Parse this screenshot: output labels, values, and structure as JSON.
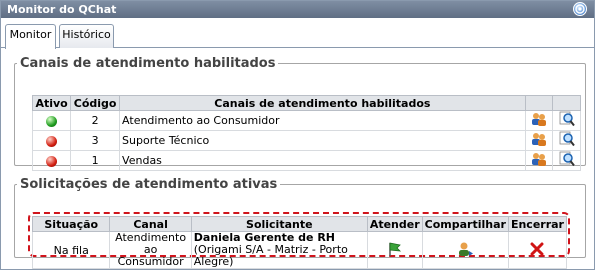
{
  "window": {
    "title": "Monitor do QChat"
  },
  "tabs": [
    {
      "label": "Monitor",
      "active": true
    },
    {
      "label": "Histórico",
      "active": false
    }
  ],
  "channels": {
    "legend": "Canais de atendimento habilitados",
    "columns": [
      "Ativo",
      "Código",
      "Canais de atendimento habilitados",
      "",
      ""
    ],
    "rows": [
      {
        "status": "green",
        "code": "2",
        "name": "Atendimento ao Consumidor"
      },
      {
        "status": "red",
        "code": "3",
        "name": "Suporte Técnico"
      },
      {
        "status": "red",
        "code": "1",
        "name": "Vendas"
      }
    ]
  },
  "requests": {
    "legend": "Solicitações de atendimento ativas",
    "columns": [
      "Situação",
      "Canal",
      "Solicitante",
      "Atender",
      "Compartilhar",
      "Encerrar"
    ],
    "rows": [
      {
        "situation": "Na fila",
        "channel": "Atendimento ao Consumidor",
        "requester_name": "Daniela Gerente de RH",
        "requester_org": " (Origami S/A - Matriz - Porto Alegre)"
      }
    ]
  },
  "colors": {
    "titlebar": "#6b7a90",
    "highlight": "#d0141c",
    "active": "#1f9c1f",
    "inactive": "#d21e10"
  },
  "icons": [
    "help-icon",
    "status-green-icon",
    "status-red-icon",
    "users-icon",
    "search-icon",
    "flag-icon",
    "share-user-icon",
    "close-x-icon"
  ]
}
